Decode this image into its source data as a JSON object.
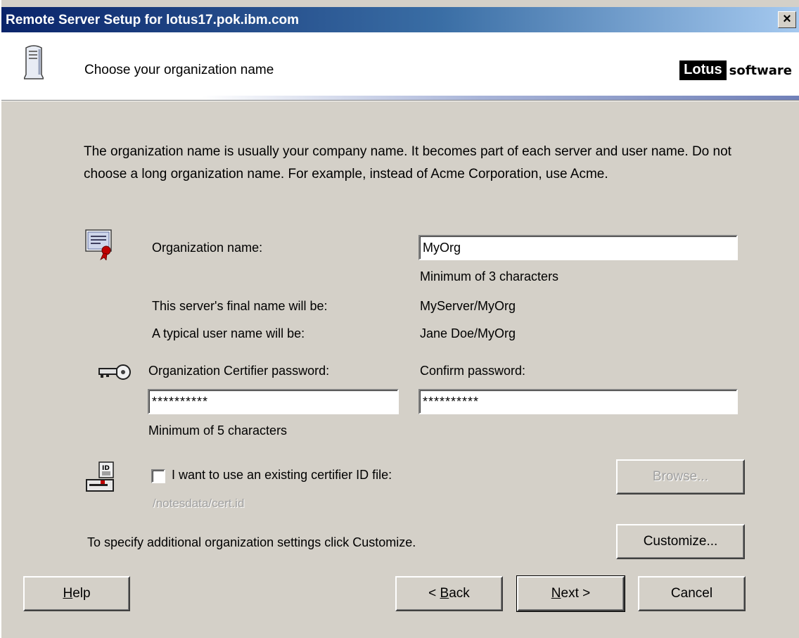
{
  "window": {
    "title": "Remote Server Setup for lotus17.pok.ibm.com",
    "close_glyph": "×"
  },
  "header": {
    "text": "Choose your organization name",
    "brand_box": "Lotus",
    "brand_text": "software"
  },
  "intro": "The organization name is usually your company name. It becomes part of each server and user name. Do not choose a long organization name. For example, instead of Acme Corporation, use Acme.",
  "org": {
    "label": "Organization name:",
    "value": "MyOrg",
    "hint": "Minimum of 3 characters",
    "server_label": "This server's final name will be:",
    "server_value": "MyServer/MyOrg",
    "user_label": "A typical user name will be:",
    "user_value": "Jane Doe/MyOrg"
  },
  "password": {
    "certifier_label": "Organization Certifier password:",
    "certifier_value": "**********",
    "confirm_label": "Confirm password:",
    "confirm_value": "**********",
    "hint": "Minimum of 5 characters"
  },
  "certifier_id": {
    "checkbox_label": "I want to use an existing certifier ID file:",
    "checked": false,
    "path": "/notesdata/cert.id",
    "browse_label": "Browse..."
  },
  "customize": {
    "text": "To specify additional organization settings click Customize.",
    "button_label": "Customize..."
  },
  "footer": {
    "help_prefix": "",
    "help_accel": "H",
    "help_rest": "elp",
    "back_prefix": "< ",
    "back_accel": "B",
    "back_rest": "ack",
    "next_prefix": "",
    "next_accel": "N",
    "next_rest": "ext >",
    "cancel_label": "Cancel"
  },
  "icons": [
    "server-icon",
    "certificate-icon",
    "key-icon",
    "id-file-icon"
  ]
}
